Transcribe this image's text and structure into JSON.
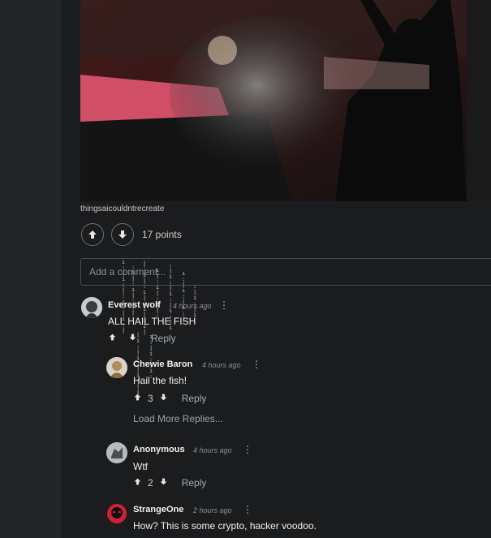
{
  "post": {
    "caption": "thingsaicouldntrecreate",
    "points_label": "17 points",
    "add_comment_placeholder": "Add a comment..."
  },
  "comments": [
    {
      "author": "Everest wolf",
      "time": "4 hours ago",
      "text": "ALL HAIL THE FISH",
      "votes": "",
      "reply_label": "Reply"
    },
    {
      "author": "Chewie Baron",
      "time": "4 hours ago",
      "text": "Hail the fish!",
      "votes": "3",
      "reply_label": "Reply",
      "load_more": "Load More Replies..."
    },
    {
      "author": "Anonymous",
      "time": "4 hours ago",
      "text": "Wtf",
      "votes": "2",
      "reply_label": "Reply"
    },
    {
      "author": "StrangeOne",
      "time": "2 hours ago",
      "text": "How? This is some crypto, hacker voodoo."
    }
  ],
  "icons": {
    "upvote": "arrow-up-icon",
    "downvote": "arrow-down-icon",
    "more": "more-vertical-icon"
  },
  "colors": {
    "background": "#1b1c1e",
    "left_rail": "#232628"
  }
}
